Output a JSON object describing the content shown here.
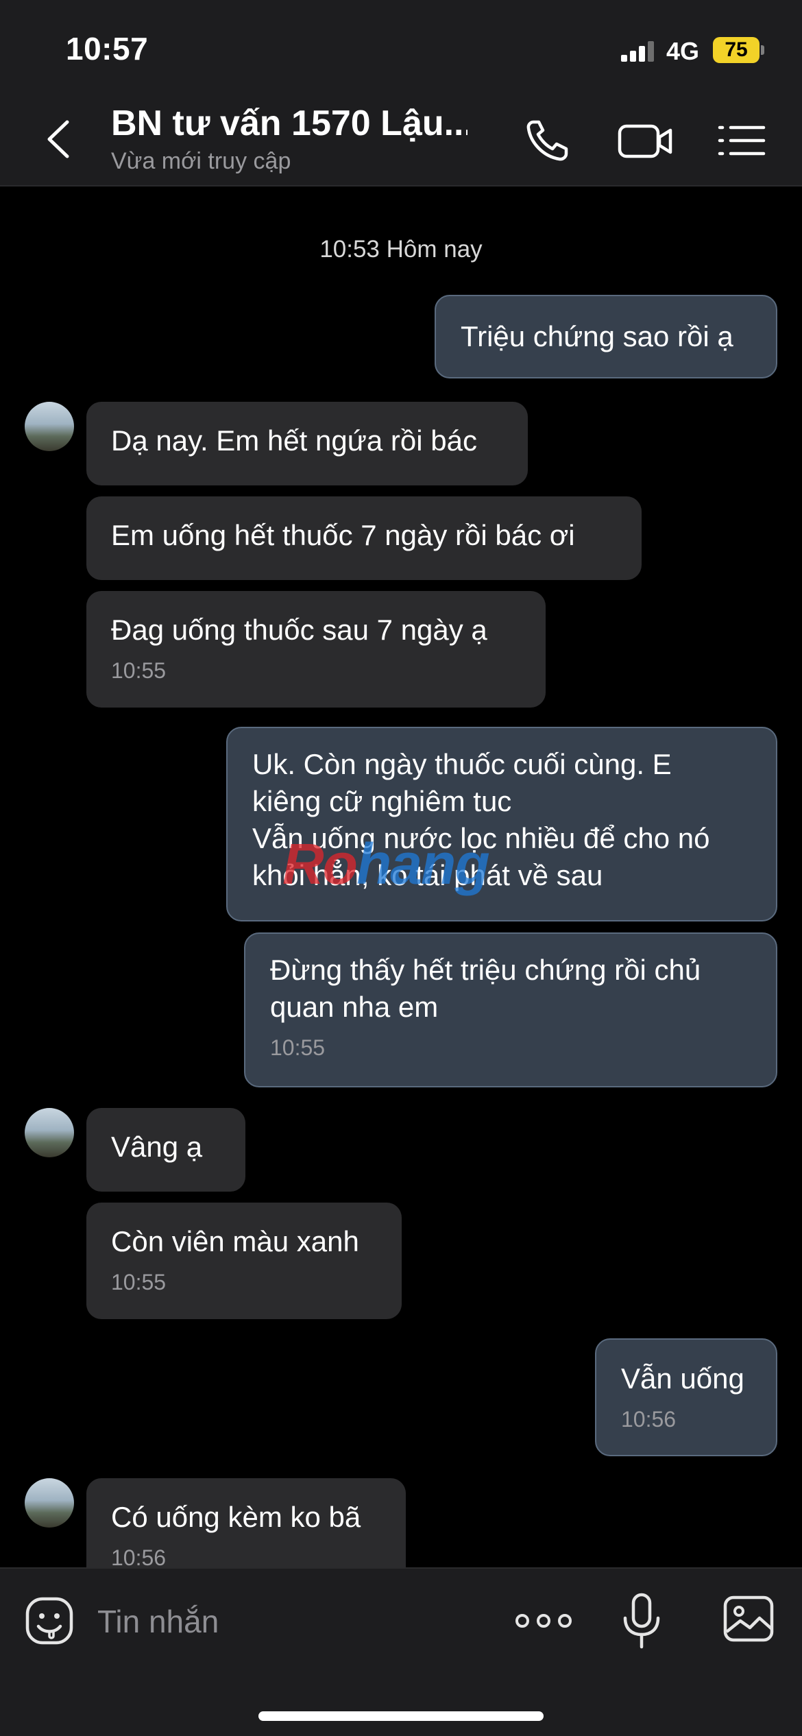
{
  "status_bar": {
    "time": "10:57",
    "network": "4G",
    "battery": "75"
  },
  "header": {
    "title": "BN tư vấn 1570 Lậu...",
    "subtitle": "Vừa mới truy cập"
  },
  "chat": {
    "date_separator": "10:53 Hôm nay",
    "messages": [
      {
        "direction": "out",
        "text": "Triệu chứng sao rồi ạ"
      },
      {
        "direction": "in",
        "text": "Dạ nay. Em hết ngứa rồi bác"
      },
      {
        "direction": "in",
        "text": "Em uống hết thuốc 7 ngày rồi bác ơi"
      },
      {
        "direction": "in",
        "text": "Đag uống thuốc sau 7 ngày ạ",
        "time": "10:55"
      },
      {
        "direction": "out",
        "text": "Uk. Còn ngày thuốc cuối cùng. E\nkiêng cữ nghiêm tuc\nVẫn uống nước lọc nhiều để cho nó\nkhỏi hẳn, ko tái phát về sau"
      },
      {
        "direction": "out",
        "text": "Đừng thấy hết triệu chứng rồi chủ\nquan nha em",
        "time": "10:55"
      },
      {
        "direction": "in",
        "text": "Vâng ạ"
      },
      {
        "direction": "in",
        "text": "Còn viên màu xanh",
        "time": "10:55"
      },
      {
        "direction": "out",
        "text": "Vẫn uống",
        "time": "10:56"
      },
      {
        "direction": "in",
        "text": "Có uống kèm ko bã",
        "time": "10:56"
      }
    ],
    "watermark": {
      "part1": "Ro",
      "part2": "hang"
    }
  },
  "input_bar": {
    "placeholder": "Tin nhắn"
  },
  "colors": {
    "incoming_bubble": "#2b2b2d",
    "outgoing_bubble": "#36404d",
    "battery": "#f2d228",
    "background": "#000000"
  }
}
